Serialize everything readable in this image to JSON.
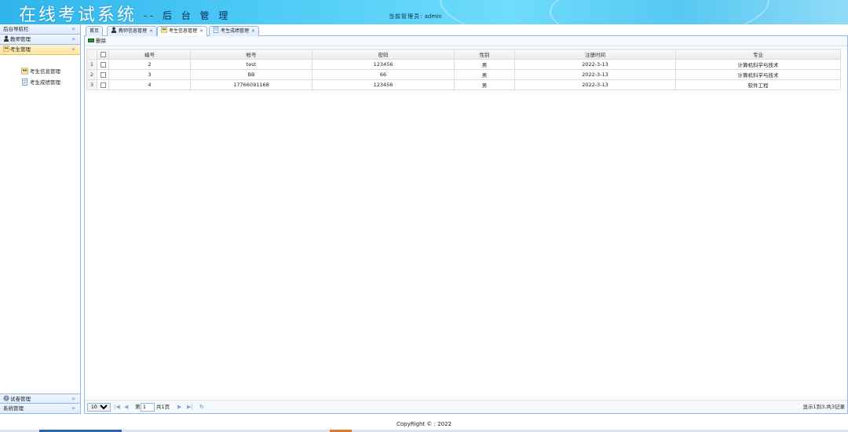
{
  "header": {
    "brand": "在线考试系统",
    "subtitle": "-- 后 台 管 理",
    "admin_label": "当前管理员:",
    "admin_name": "admin"
  },
  "sidebar": {
    "title": "后台导航栏",
    "collapse_icon": "double-chevron-left-icon",
    "panels": [
      {
        "label": "教师管理",
        "icon": "user-icon"
      },
      {
        "label": "考生管理",
        "icon": "users-icon",
        "expanded": true
      }
    ],
    "sub_items": [
      {
        "label": "考生信息管理",
        "icon": "users-icon"
      },
      {
        "label": "考生成绩管理",
        "icon": "document-icon"
      }
    ],
    "bottom_panels": [
      {
        "label": "试卷管理",
        "icon": "question-icon"
      },
      {
        "label": "系统管理",
        "icon": ""
      }
    ]
  },
  "tabs": [
    {
      "label": "首页",
      "closable": false
    },
    {
      "label": "教师信息管理",
      "closable": true,
      "icon": "user-icon"
    },
    {
      "label": "考生信息管理",
      "closable": true,
      "icon": "users-icon",
      "active": true
    },
    {
      "label": "考生成绩管理",
      "closable": true,
      "icon": "document-icon"
    }
  ],
  "tab_close": "×",
  "toolbar": {
    "delete_label": "删除"
  },
  "table": {
    "columns": [
      "编号",
      "帐号",
      "密码",
      "性别",
      "注册时间",
      "专业"
    ],
    "rows": [
      {
        "rn": "1",
        "cells": [
          "2",
          "test",
          "123456",
          "男",
          "2022-3-13",
          "计算机科学与技术"
        ]
      },
      {
        "rn": "2",
        "cells": [
          "3",
          "BB",
          "66",
          "男",
          "2022-3-13",
          "计算机科学与技术"
        ]
      },
      {
        "rn": "3",
        "cells": [
          "4",
          "17766091168",
          "123456",
          "男",
          "2022-3-13",
          "软件工程"
        ]
      }
    ]
  },
  "pager": {
    "page_size": "10",
    "page_prefix": "第",
    "page_value": "1",
    "page_suffix": "共1页",
    "info": "显示1到3,共3记录"
  },
  "footer": "CopyRight © : 2022",
  "colors": {
    "header": "#4ccaf6",
    "border": "#95b8e7",
    "selected_panel": "#fde6a3"
  }
}
